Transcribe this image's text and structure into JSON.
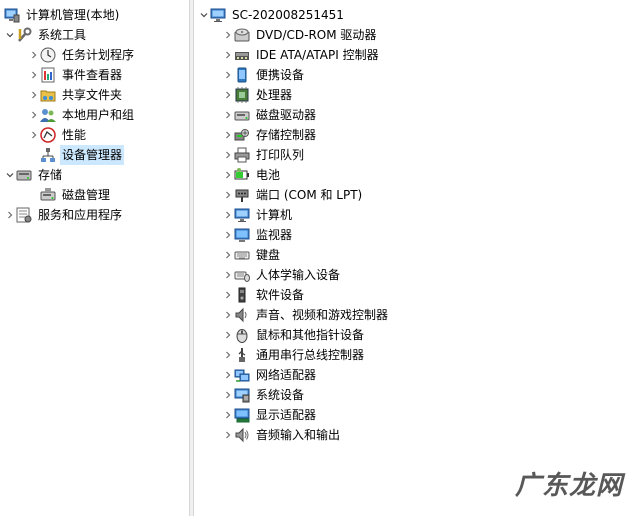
{
  "left_tree": {
    "root": "计算机管理(本地)",
    "system_tools": "系统工具",
    "task_scheduler": "任务计划程序",
    "event_viewer": "事件查看器",
    "shared_folders": "共享文件夹",
    "local_users": "本地用户和组",
    "performance": "性能",
    "device_manager": "设备管理器",
    "storage": "存储",
    "disk_management": "磁盘管理",
    "services_apps": "服务和应用程序"
  },
  "device_tree": {
    "computer_name": "SC-202008251451",
    "categories": [
      {
        "label": "DVD/CD-ROM 驱动器",
        "icon": "dvd-drive-icon"
      },
      {
        "label": "IDE ATA/ATAPI 控制器",
        "icon": "ide-controller-icon"
      },
      {
        "label": "便携设备",
        "icon": "portable-device-icon"
      },
      {
        "label": "处理器",
        "icon": "processor-icon"
      },
      {
        "label": "磁盘驱动器",
        "icon": "disk-drive-icon"
      },
      {
        "label": "存储控制器",
        "icon": "storage-controller-icon"
      },
      {
        "label": "打印队列",
        "icon": "printer-icon"
      },
      {
        "label": "电池",
        "icon": "battery-icon"
      },
      {
        "label": "端口 (COM 和 LPT)",
        "icon": "port-icon"
      },
      {
        "label": "计算机",
        "icon": "computer-icon"
      },
      {
        "label": "监视器",
        "icon": "monitor-icon"
      },
      {
        "label": "键盘",
        "icon": "keyboard-icon"
      },
      {
        "label": "人体学输入设备",
        "icon": "hid-icon"
      },
      {
        "label": "软件设备",
        "icon": "software-device-icon"
      },
      {
        "label": "声音、视频和游戏控制器",
        "icon": "sound-icon"
      },
      {
        "label": "鼠标和其他指针设备",
        "icon": "mouse-icon"
      },
      {
        "label": "通用串行总线控制器",
        "icon": "usb-icon"
      },
      {
        "label": "网络适配器",
        "icon": "network-adapter-icon"
      },
      {
        "label": "系统设备",
        "icon": "system-device-icon"
      },
      {
        "label": "显示适配器",
        "icon": "display-adapter-icon"
      },
      {
        "label": "音频输入和输出",
        "icon": "audio-io-icon"
      }
    ]
  },
  "watermark": "广东龙网",
  "colors": {
    "selection": "#cce8ff",
    "chevron": "#6b6b6b"
  }
}
